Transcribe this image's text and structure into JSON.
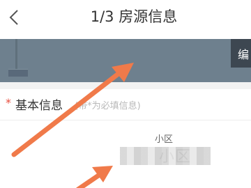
{
  "header": {
    "title": "1/3 房源信息"
  },
  "banner": {
    "edit_label": "编"
  },
  "section": {
    "required_mark": "*",
    "title": "基本信息",
    "hint": "(带*为必填信息)"
  },
  "field": {
    "label": "小区",
    "value": "小区"
  },
  "colors": {
    "accent_arrow": "#f07a4a",
    "required": "#e84d3d",
    "banner": "#6e808e"
  }
}
